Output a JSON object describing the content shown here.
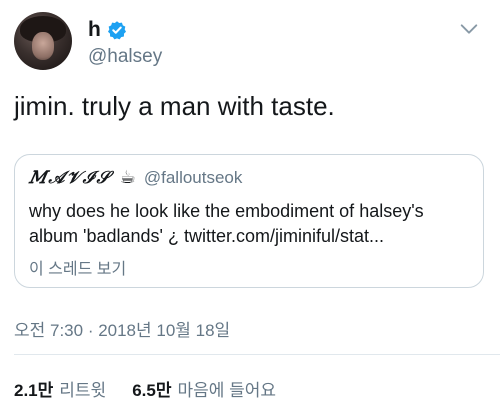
{
  "author": {
    "display_name": "h",
    "handle": "@halsey"
  },
  "tweet": {
    "text": "jimin. truly a man with taste."
  },
  "quoted_tweet": {
    "display_name": "𝑀𝒜𝒱ℐ𝒮",
    "emoji": "☕",
    "handle": "@falloutseok",
    "text": "why does he look like the embodiment of halsey's album 'badlands' ¿ twitter.com/jiminiful/stat...",
    "thread_link": "이 스레드 보기"
  },
  "timestamp": "오전 7:30 · 2018년 10월 18일",
  "stats": {
    "retweets_count": "2.1만",
    "retweets_label": "리트윗",
    "likes_count": "6.5만",
    "likes_label": "마음에 들어요"
  },
  "colors": {
    "verified_blue": "#1da1f2",
    "secondary_text": "#657786",
    "border": "#ccd6dd"
  },
  "icons": {
    "verified": "verified-badge-icon",
    "more": "chevron-down-icon"
  }
}
